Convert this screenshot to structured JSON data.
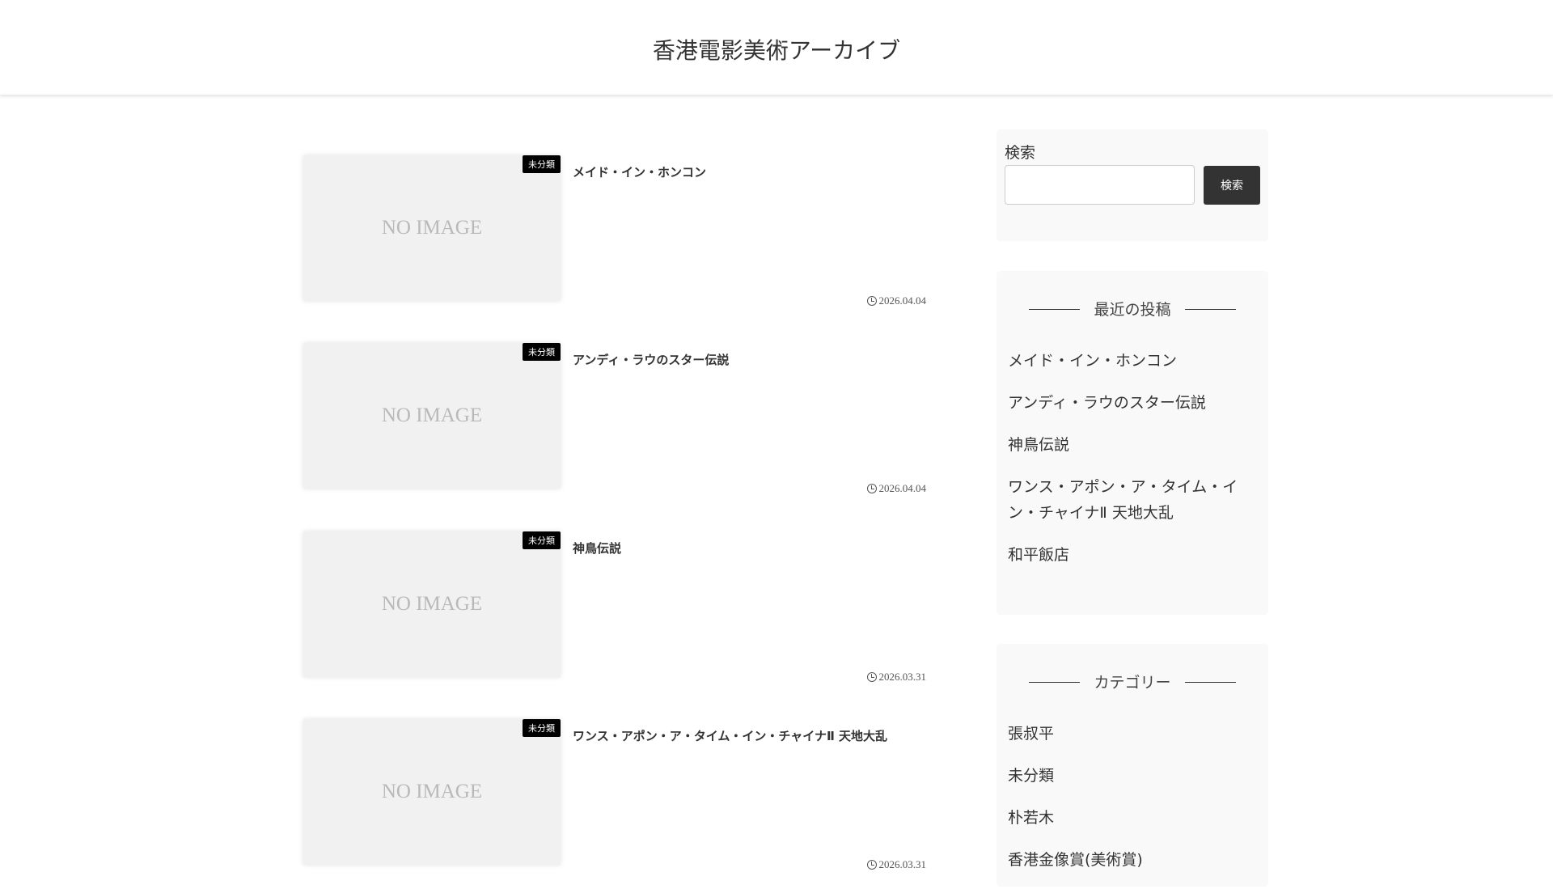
{
  "site": {
    "title": "香港電影美術アーカイブ"
  },
  "posts": [
    {
      "title": "メイド・イン・ホンコン",
      "category": "未分類",
      "date": "2026.04.04",
      "thumb": "NO IMAGE"
    },
    {
      "title": "アンディ・ラウのスター伝説",
      "category": "未分類",
      "date": "2026.04.04",
      "thumb": "NO IMAGE"
    },
    {
      "title": "神鳥伝説",
      "category": "未分類",
      "date": "2026.03.31",
      "thumb": "NO IMAGE"
    },
    {
      "title": "ワンス・アポン・ア・タイム・イン・チャイナⅡ 天地大乱",
      "category": "未分類",
      "date": "2026.03.31",
      "thumb": "NO IMAGE"
    }
  ],
  "sidebar": {
    "search": {
      "label": "検索",
      "button": "検索",
      "value": ""
    },
    "recent": {
      "title": "最近の投稿",
      "items": [
        "メイド・イン・ホンコン",
        "アンディ・ラウのスター伝説",
        "神鳥伝説",
        "ワンス・アポン・ア・タイム・イン・チャイナⅡ 天地大乱",
        "和平飯店"
      ]
    },
    "categories": {
      "title": "カテゴリー",
      "items": [
        "張叔平",
        "未分類",
        "朴若木",
        "香港金像賞(美術賞)"
      ]
    }
  }
}
